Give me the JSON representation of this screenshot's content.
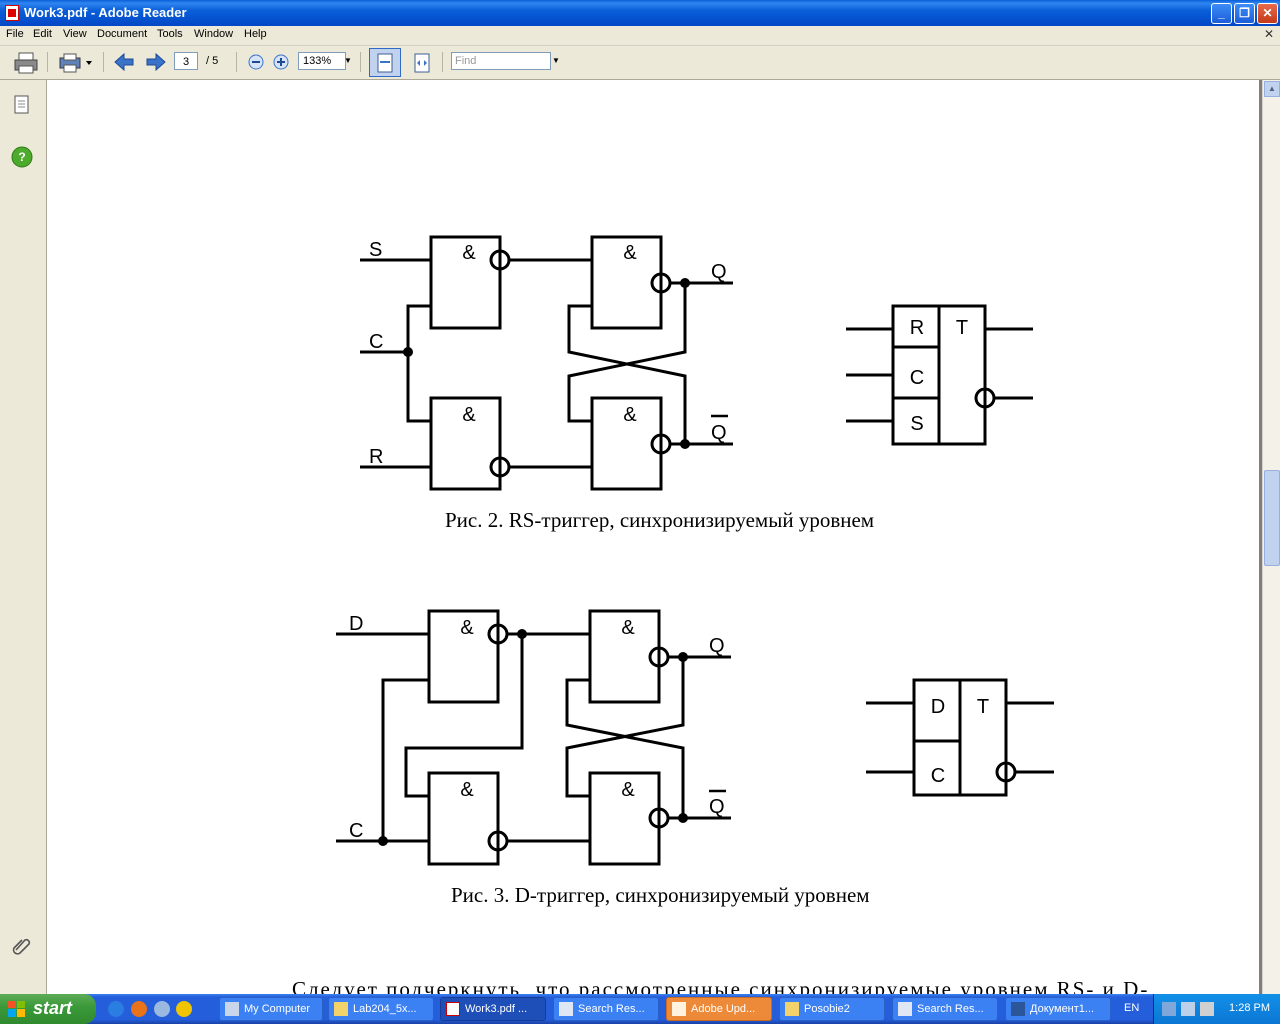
{
  "window": {
    "title": "Work3.pdf - Adobe Reader"
  },
  "menu": [
    "File",
    "Edit",
    "View",
    "Document",
    "Tools",
    "Window",
    "Help"
  ],
  "toolbar": {
    "current_page": "3",
    "total_pages": "/ 5",
    "zoom": "133%",
    "find_placeholder": "Find"
  },
  "figure2": {
    "caption": "Рис. 2. RS-триггер, синхронизируемый уровнем",
    "gate_symbol": "&",
    "inputs": [
      "S",
      "C",
      "R"
    ],
    "outputs": [
      "Q",
      "Q"
    ],
    "block": {
      "cells": [
        "R",
        "C",
        "S"
      ],
      "type": "T"
    }
  },
  "figure3": {
    "caption": "Рис. 3. D-триггер, синхронизируемый уровнем",
    "gate_symbol": "&",
    "inputs": [
      "D",
      "C"
    ],
    "outputs": [
      "Q",
      "Q"
    ],
    "block": {
      "cells": [
        "D",
        "C"
      ],
      "type": "T"
    }
  },
  "body_text": "Следует  подчеркнуть,  что  рассмотренные  синхронизируемые  уровнем  RS-  и  D-",
  "taskbar": {
    "start_label": "start",
    "tasks": [
      "My Computer",
      "Lab204_5x...",
      "Work3.pdf ...",
      "Search Res...",
      "Adobe Upd...",
      "Posobie2",
      "Search Res...",
      "Документ1..."
    ],
    "language": "EN",
    "clock": "1:28 PM"
  }
}
